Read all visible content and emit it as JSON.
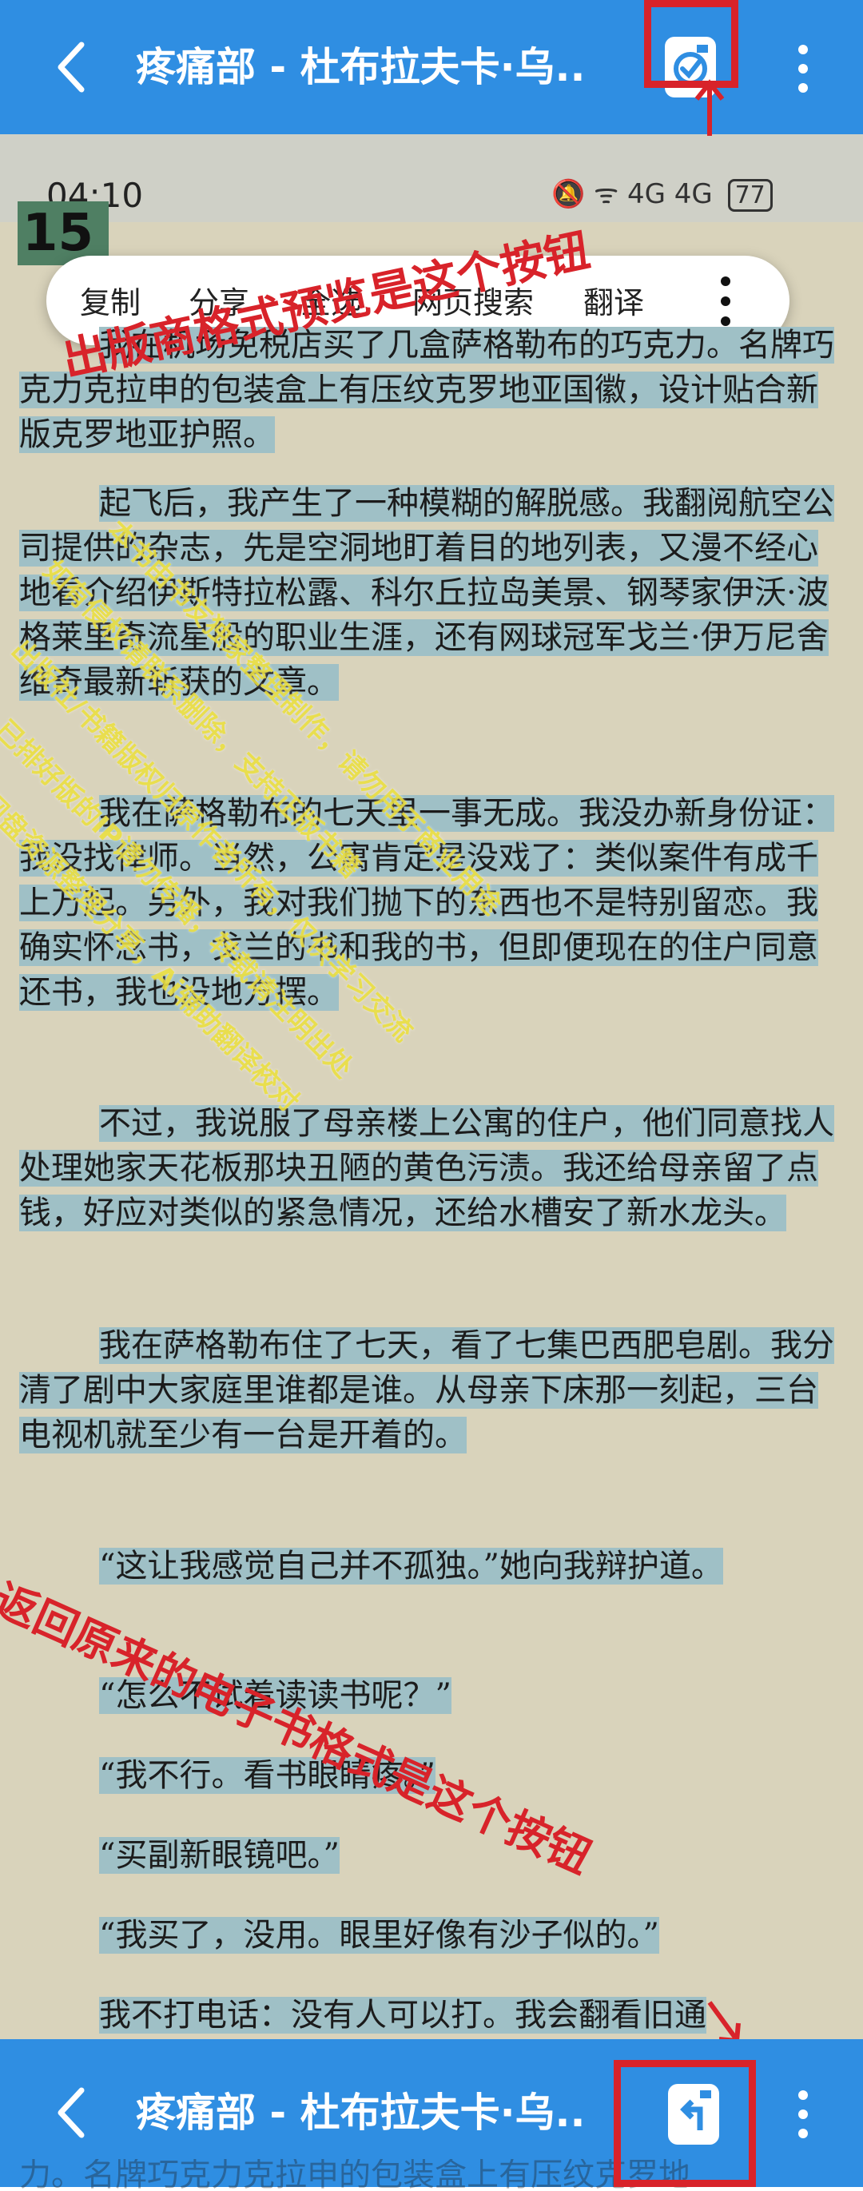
{
  "app_bar": {
    "title": "疼痛部 - 杜布拉夫卡·乌..",
    "back_icon": "back-arrow-icon",
    "publisher_format_icon": "publisher-format-preview-icon",
    "ebook_format_icon": "return-ebook-format-icon",
    "more_icon": "more-vert-icon",
    "color": "#2f8ee2"
  },
  "inner_status": {
    "time": "04:10",
    "icons": "🔕 ᯤ 4G 4G",
    "battery": "77"
  },
  "chapter_number": "15",
  "context_menu": {
    "items": [
      "复制",
      "分享",
      "全选",
      "网页搜索",
      "翻译"
    ]
  },
  "paragraphs": [
    "我在机场免税店买了几盒萨格勒布的巧克力。名牌巧克力克拉申的包装盒上有压纹克罗地亚国徽，设计贴合新版克罗地亚护照。",
    "起飞后，我产生了一种模糊的解脱感。我翻阅航空公司提供的杂志，先是空洞地盯着目的地列表，又漫不经心地看介绍伊斯特拉松露、科尔丘拉岛美景、钢琴家伊沃·波格莱里奇流星般的职业生涯，还有网球冠军戈兰·伊万尼舍维奇最新斩获的文章。",
    "我在萨格勒布的七天里一事无成。我没办新身份证：我没找律师。当然，公寓肯定是没戏了：类似案件有成千上万起。另外，我对我们抛下的东西也不是特别留恋。我确实怀念书，戈兰的书和我的书，但即便现在的住户同意还书，我也没地方摆。",
    "不过，我说服了母亲楼上公寓的住户，他们同意找人处理她家天花板那块丑陋的黄色污渍。我还给母亲留了点钱，好应对类似的紧急情况，还给水槽安了新水龙头。",
    "我在萨格勒布住了七天，看了七集巴西肥皂剧。我分清了剧中大家庭里谁都是谁。从母亲下床那一刻起，三台电视机就至少有一台是开着的。",
    "“这让我感觉自己并不孤独。”她向我辩护道。",
    "“怎么不试着读读书呢？”",
    "“我不行。看书眼睛疼。”",
    "“买副新眼镜吧。”",
    "“我买了，没用。眼里好像有沙子似的。”",
    "我不打电话：没有人可以打。我会翻看旧通"
  ],
  "bottom_peek_text": "力。名牌巧克力克拉申的包装盒上有压纹克罗地",
  "annotations": {
    "top_label": "出版商格式预览是这个按钮",
    "bottom_label": "返回原来的电子书格式是这个按钮",
    "color": "#d8232a"
  },
  "watermark": {
    "lines": [
      "出版社/书籍版权归原作者所有，仅供学习交流",
      "已排好版的IP请勿传播，转载请注明出处",
      "网盘资源整理分享，Ai辅助翻译校对",
      "本书由书友独家整理制作，请勿用于商业用途",
      "如有侵权请联系删除，支持正版书籍"
    ],
    "color": "#ebe043"
  }
}
